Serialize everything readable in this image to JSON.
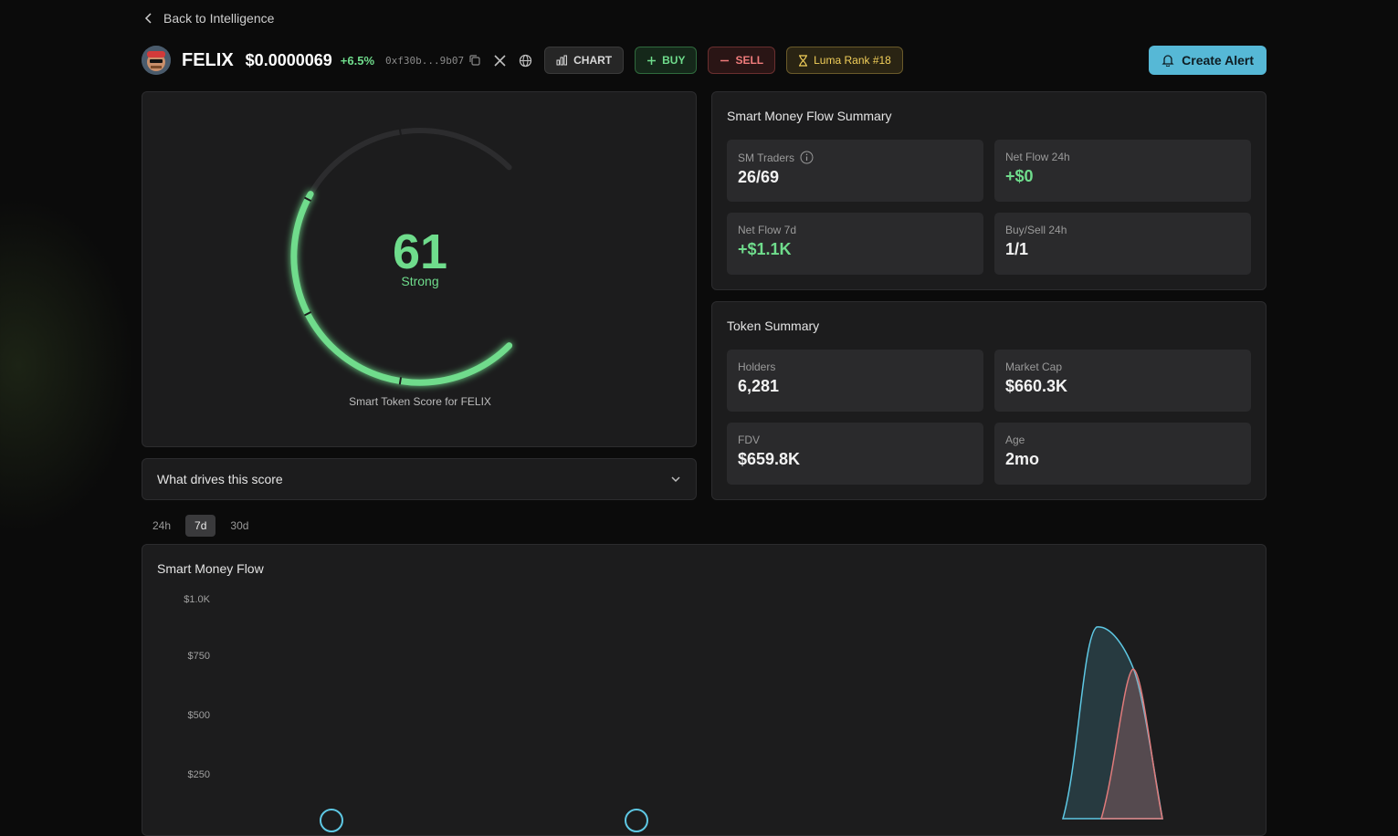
{
  "nav": {
    "back_label": "Back to Intelligence"
  },
  "token": {
    "symbol": "FELIX",
    "price": "$0.0000069",
    "change": "+6.5%",
    "address": "0xf30b...9b07"
  },
  "actions": {
    "chart_label": "CHART",
    "buy_label": "BUY",
    "sell_label": "SELL",
    "rank_label": "Luma Rank #18",
    "create_alert_label": "Create Alert"
  },
  "score": {
    "value": "61",
    "rating": "Strong",
    "caption": "Smart Token Score for FELIX",
    "fill_fraction": 0.61,
    "color": "#6fdc8c"
  },
  "drives": {
    "label": "What drives this score"
  },
  "smart_money_summary": {
    "title": "Smart Money Flow Summary",
    "stats": [
      {
        "label": "SM Traders",
        "value": "26/69"
      },
      {
        "label": "Net Flow 24h",
        "value": "+$0"
      },
      {
        "label": "Net Flow 7d",
        "value": "+$1.1K"
      },
      {
        "label": "Buy/Sell 24h",
        "value": "1/1"
      }
    ]
  },
  "token_summary": {
    "title": "Token Summary",
    "stats": [
      {
        "label": "Holders",
        "value": "6,281"
      },
      {
        "label": "Market Cap",
        "value": "$660.3K"
      },
      {
        "label": "FDV",
        "value": "$659.8K"
      },
      {
        "label": "Age",
        "value": "2mo"
      }
    ]
  },
  "timeframes": {
    "tabs": [
      "24h",
      "7d",
      "30d"
    ],
    "active": "7d"
  },
  "flow_chart": {
    "title": "Smart Money Flow",
    "y_ticks": [
      "$1.0K",
      "$750",
      "$500",
      "$250"
    ],
    "colors": {
      "buy": "#5ec8e4",
      "sell": "#e07b7b"
    }
  }
}
